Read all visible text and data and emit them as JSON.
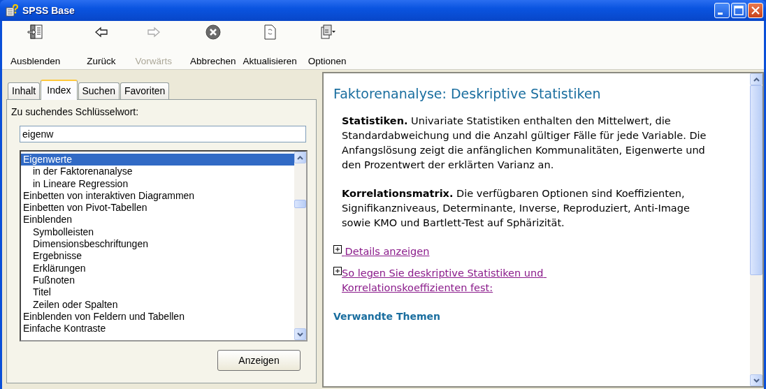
{
  "window": {
    "title": "SPSS Base"
  },
  "toolbar": [
    {
      "kind": "hide",
      "label": "Ausblenden",
      "disabled": false
    },
    {
      "kind": "back",
      "label": "Zurück",
      "disabled": false
    },
    {
      "kind": "forward",
      "label": "Vorwärts",
      "disabled": true
    },
    {
      "kind": "stop",
      "label": "Abbrechen",
      "disabled": false
    },
    {
      "kind": "refresh",
      "label": "Aktualisieren",
      "disabled": false
    },
    {
      "kind": "options",
      "label": "Optionen",
      "disabled": false
    }
  ],
  "tabs": [
    {
      "label": "Inhalt",
      "selected": false
    },
    {
      "label": "Index",
      "selected": true
    },
    {
      "label": "Suchen",
      "selected": false
    },
    {
      "label": "Favoriten",
      "selected": false
    }
  ],
  "keyword": {
    "label": "Zu suchendes Schlüsselwort:",
    "value": "eigenw"
  },
  "index_list": [
    {
      "label": "Eigenwerte",
      "selected": true,
      "children": [
        {
          "label": "in der Faktorenanalyse",
          "selected": false
        },
        {
          "label": "in Lineare Regression",
          "selected": false
        }
      ]
    },
    {
      "label": "Einbetten von interaktiven Diagrammen",
      "selected": false
    },
    {
      "label": "Einbetten von Pivot-Tabellen",
      "selected": false
    },
    {
      "label": "Einblenden",
      "selected": false,
      "children": [
        {
          "label": "Symbolleisten",
          "selected": false
        },
        {
          "label": "Dimensionsbeschriftungen",
          "selected": false
        },
        {
          "label": "Ergebnisse",
          "selected": false
        },
        {
          "label": "Erklärungen",
          "selected": false
        },
        {
          "label": "Fußnoten",
          "selected": false
        },
        {
          "label": "Titel",
          "selected": false
        },
        {
          "label": "Zeilen oder Spalten",
          "selected": false
        }
      ]
    },
    {
      "label": "Einblenden von Feldern und Tabellen",
      "selected": false
    },
    {
      "label": "Einfache Kontraste",
      "selected": false
    }
  ],
  "display_button": "Anzeigen",
  "content": {
    "title": "Faktorenanalyse: Deskriptive Statistiken",
    "paragraphs": [
      "**Statistiken.** Univariate Statistiken enthalten den Mittelwert, die Standardabweichung und die Anzahl gültiger Fälle für jede Variable. Die Anfangslösung zeigt die anfänglichen Kommunalitäten, Eigenwerte und den Prozentwert der erklärten Varianz an.",
      "**Korrelationsmatrix.** Die verfügbaren Optionen sind Koeffizienten, Signifikanzniveaus, Determinante, Inverse, Reproduziert, Anti-Image sowie KMO und Bartlett-Test auf Sphärizität."
    ],
    "links": [
      " Details anzeigen",
      "So legen Sie deskriptive Statistiken und Korrelationskoeffizienten fest:"
    ],
    "related_heading": "Verwandte Themen"
  }
}
